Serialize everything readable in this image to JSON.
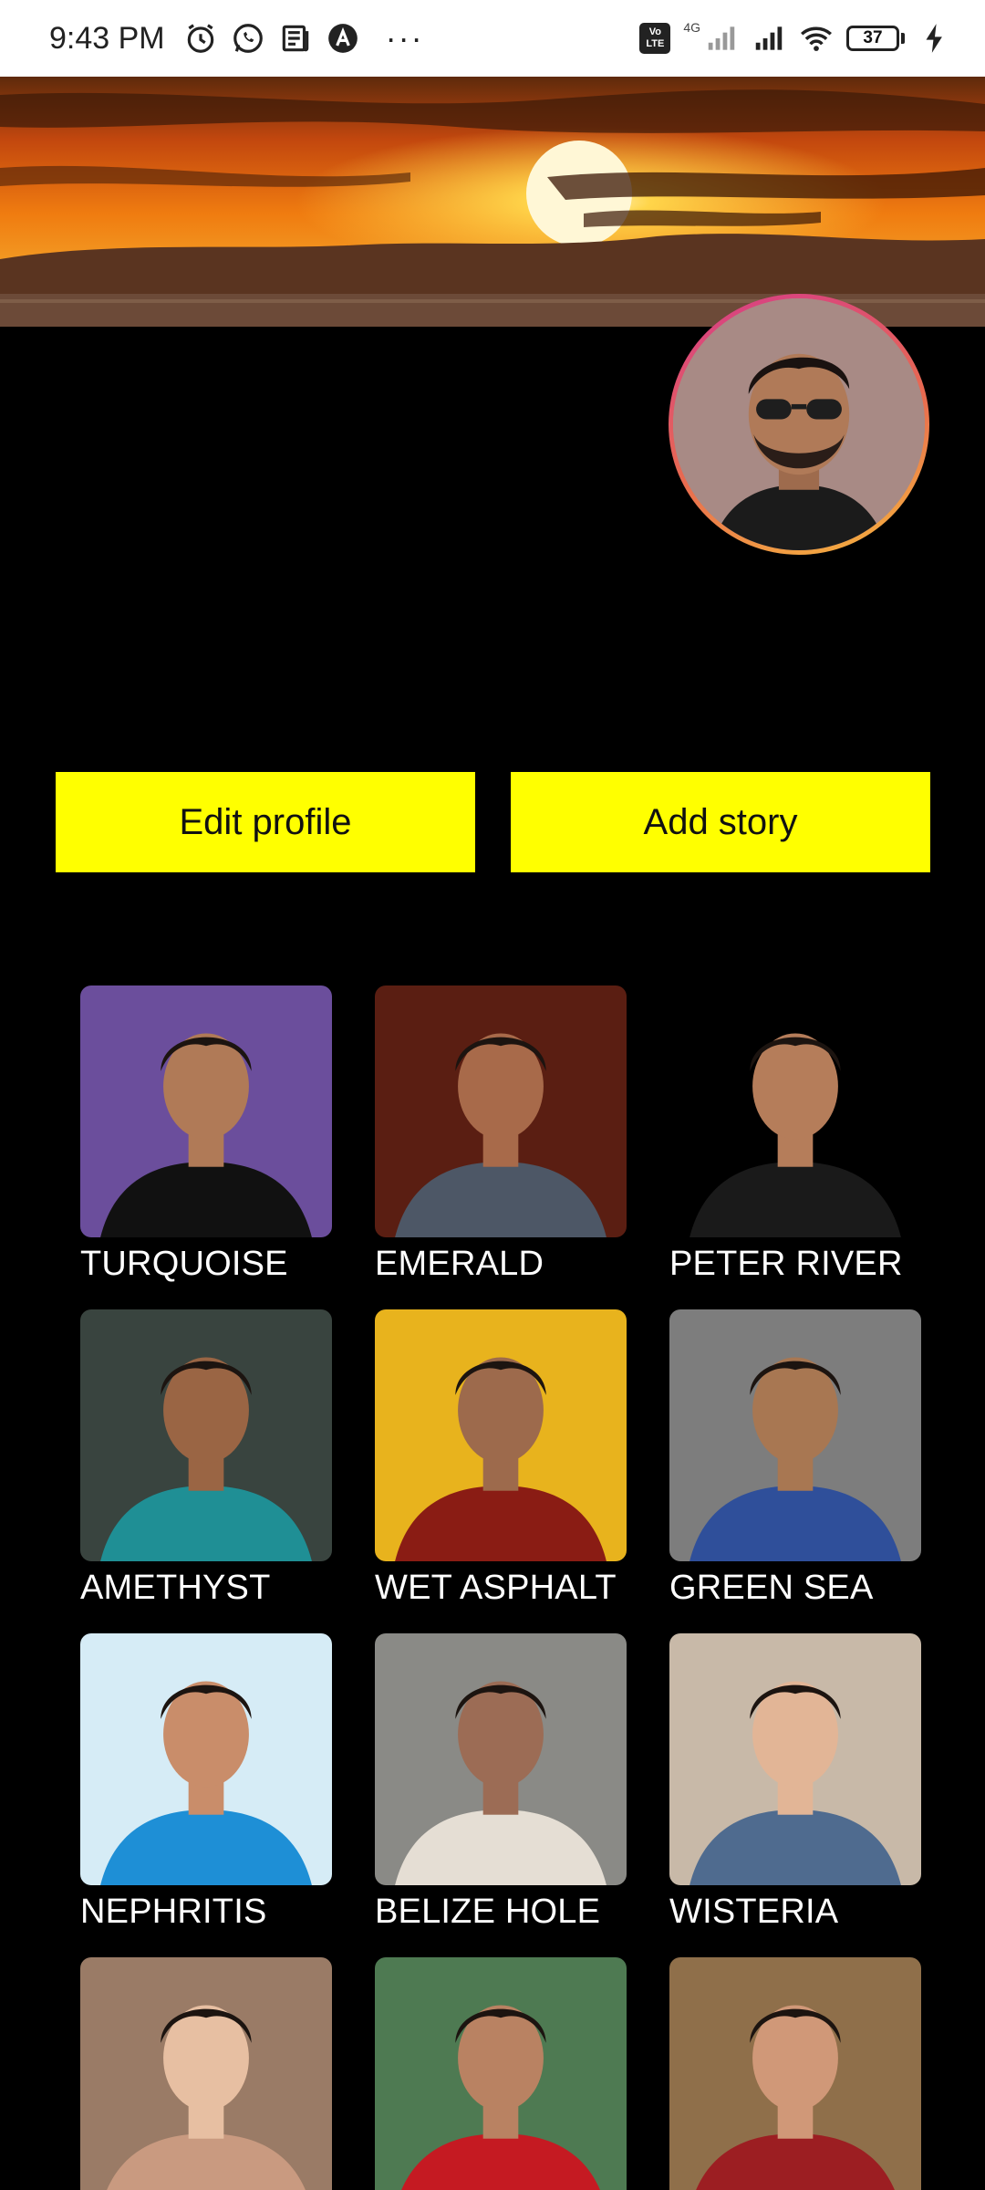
{
  "status_bar": {
    "time": "9:43 PM",
    "left_icons": [
      "alarm-icon",
      "whatsapp-icon",
      "news-icon",
      "app-a-icon",
      "more-dots-icon"
    ],
    "more": "···",
    "volte": "Vo LTE",
    "network": "4G",
    "battery_level": "37",
    "battery_fraction": 0.37
  },
  "profile": {
    "banner": "sunset-cover-photo",
    "avatar": "profile-avatar-photo"
  },
  "actions": {
    "edit_profile": "Edit profile",
    "add_story": "Add story"
  },
  "grid": {
    "items": [
      {
        "label": "TURQUOISE",
        "bg": "#6b4e9c",
        "skin": "#b07a57",
        "shirt": "#111111"
      },
      {
        "label": "EMERALD",
        "bg": "#5a1e12",
        "skin": "#a86a4a",
        "shirt": "#4d5766"
      },
      {
        "label": "PETER RIVER",
        "bg": "#000000",
        "skin": "#b57d5a",
        "shirt": "#1a1a1a"
      },
      {
        "label": "AMETHYST",
        "bg": "#39443f",
        "skin": "#9a6544",
        "shirt": "#1f8f95"
      },
      {
        "label": "WET ASPHALT",
        "bg": "#e8b31d",
        "skin": "#9d6a4c",
        "shirt": "#8a1c14"
      },
      {
        "label": "GREEN SEA",
        "bg": "#7d7d7d",
        "skin": "#a87752",
        "shirt": "#2f4f9a"
      },
      {
        "label": "NEPHRITIS",
        "bg": "#d6ecf6",
        "skin": "#c98d6a",
        "shirt": "#1e8fd6"
      },
      {
        "label": "BELIZE HOLE",
        "bg": "#8a8a86",
        "skin": "#9c6c55",
        "shirt": "#e5ded4"
      },
      {
        "label": "WISTERIA",
        "bg": "#c8b9a8",
        "skin": "#e2b596",
        "shirt": "#4f6b8f"
      },
      {
        "label": "",
        "bg": "#9a7b66",
        "skin": "#e7bfa2",
        "shirt": "#c99a80"
      },
      {
        "label": "",
        "bg": "#4e7a52",
        "skin": "#b98262",
        "shirt": "#c51a22"
      },
      {
        "label": "",
        "bg": "#8f6f4a",
        "skin": "#d09878",
        "shirt": "#9c1e22"
      }
    ]
  }
}
